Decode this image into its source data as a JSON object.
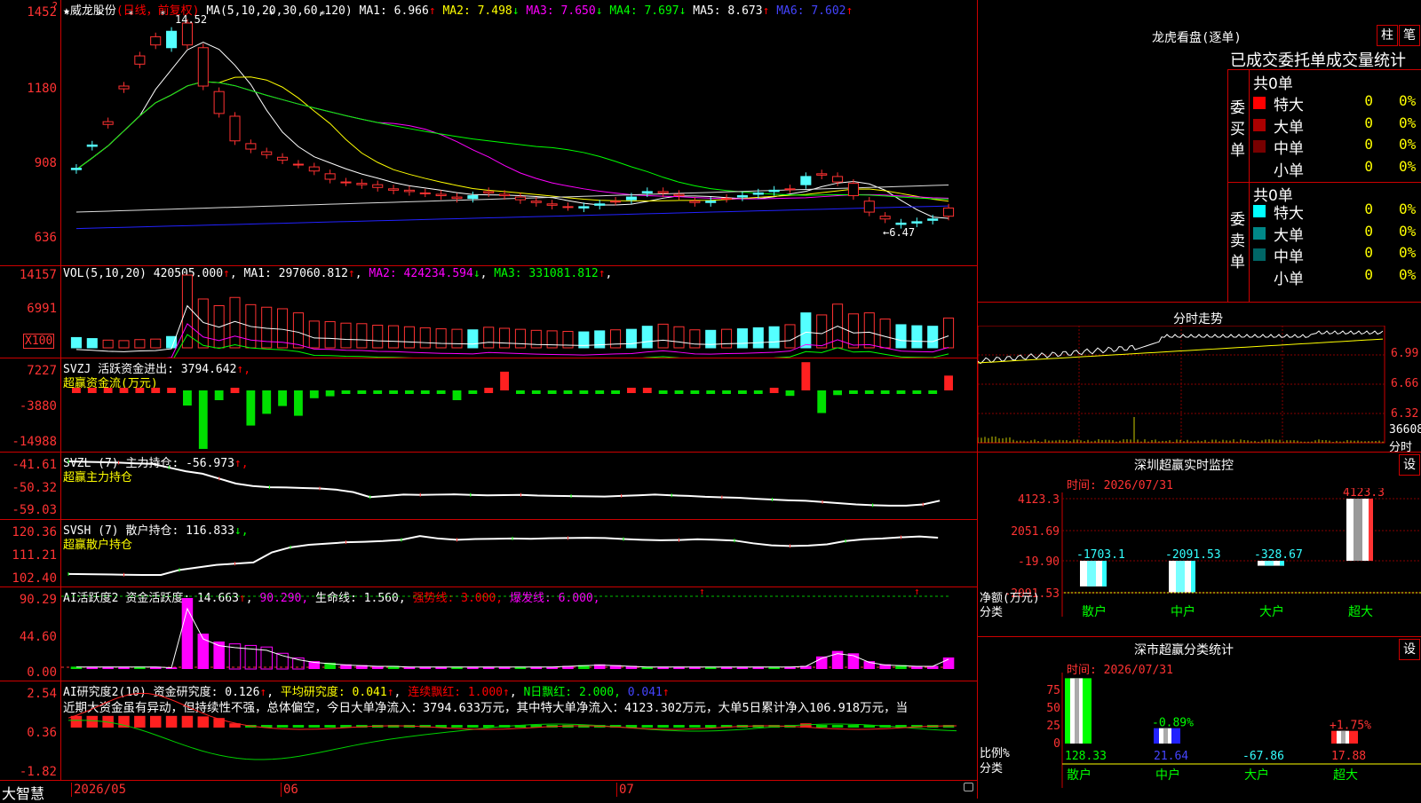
{
  "stock": {
    "name": "威龙股份",
    "mode": "(日线，前复权)"
  },
  "main": {
    "ma_label": "MA(5,10,20,30,60,120)",
    "ma": [
      {
        "label": "MA1:",
        "value": "6.966",
        "arrow": "↑",
        "color": "#ffffff"
      },
      {
        "label": "MA2:",
        "value": "7.498",
        "arrow": "↓",
        "color": "#ffff00"
      },
      {
        "label": "MA3:",
        "value": "7.650",
        "arrow": "↓",
        "color": "#ff00ff"
      },
      {
        "label": "MA4:",
        "value": "7.697",
        "arrow": "↓",
        "color": "#00ff00"
      },
      {
        "label": "MA5:",
        "value": "8.673",
        "arrow": "↑",
        "color": "#ffffff"
      },
      {
        "label": "MA6:",
        "value": "7.602",
        "arrow": "↑",
        "color": "#4444ff"
      }
    ],
    "ticks": [
      "1452",
      "1180",
      "908",
      "636"
    ],
    "high_label": "14.52",
    "low_label": "←6.47"
  },
  "vol": {
    "name": "VOL(5,10,20)",
    "value": "420505.000",
    "ma": [
      {
        "label": "MA1:",
        "value": "297060.812",
        "arrow": "↑",
        "color": "#ffffff"
      },
      {
        "label": "MA2:",
        "value": "424234.594",
        "arrow": "↓",
        "color": "#ff00ff"
      },
      {
        "label": "MA3:",
        "value": "331081.812",
        "arrow": "↑",
        "color": "#00ff00"
      }
    ],
    "ticks": [
      "14157",
      "6991"
    ],
    "unit": "X100"
  },
  "svzj": {
    "name": "SVZJ",
    "line1": "活跃资金进出: 3794.642",
    "arrow": "↑,",
    "line2": "超赢资金流(万元)",
    "ticks": [
      "7227",
      "-3880",
      "-14988"
    ]
  },
  "svzl": {
    "name": "SVZL (7)",
    "line1": "主力持仓: -56.973",
    "arrow": "↑,",
    "line2": "超赢主力持仓",
    "ticks": [
      "-41.61",
      "-50.32",
      "-59.03"
    ]
  },
  "svsh": {
    "name": "SVSH (7)",
    "line1": "散户持仓: 116.833",
    "arrow": "↓,",
    "line2": "超赢散户持仓",
    "ticks": [
      "120.36",
      "111.21",
      "102.40"
    ]
  },
  "ai1": {
    "name": "AI活跃度2",
    "label": "资金活跃度: 14.663",
    "v2": "90.290,",
    "v3": "生命线: 1.560,",
    "v4": "强势线: 3.000,",
    "v5": "爆发线: 6.000,",
    "ticks": [
      "90.29",
      "44.60",
      "0.00"
    ]
  },
  "ai2": {
    "name": "AI研究度2(10)",
    "label": "资金研究度: 0.126",
    "v2": "平均研究度: 0.041",
    "v3": "连续飘红: 1.000",
    "v4": "N日飘红: 2.000,",
    "v5": "0.041",
    "comment": "近期大资金虽有异动，但持续性不强，总体偏空，今日大单净流入：3794.633万元，其中特大单净流入：4123.302万元，大单5日累计净入106.918万元，当",
    "ticks": [
      "2.54",
      "0.36",
      "-1.82"
    ]
  },
  "xaxis": {
    "brand": "大智慧",
    "labels": [
      "2026/05",
      "06",
      "07"
    ]
  },
  "lhb": {
    "title": "龙虎看盘(逐单)",
    "btn1": "柱",
    "btn2": "笔",
    "subtitle": "已成交委托单成交量统计",
    "buy": {
      "side": "委买单",
      "count": "共0单",
      "rows": [
        {
          "label": "特大",
          "value": "0",
          "pct": "0%",
          "color": "#ff0000"
        },
        {
          "label": "大单",
          "value": "0",
          "pct": "0%",
          "color": "#aa0000"
        },
        {
          "label": "中单",
          "value": "0",
          "pct": "0%",
          "color": "#770000"
        },
        {
          "label": "小单",
          "value": "0",
          "pct": "0%",
          "color": "#000000"
        }
      ]
    },
    "sell": {
      "side": "委卖单",
      "count": "共0单",
      "rows": [
        {
          "label": "特大",
          "value": "0",
          "pct": "0%",
          "color": "#00ffff"
        },
        {
          "label": "大单",
          "value": "0",
          "pct": "0%",
          "color": "#008888"
        },
        {
          "label": "中单",
          "value": "0",
          "pct": "0%",
          "color": "#006666"
        },
        {
          "label": "小单",
          "value": "0",
          "pct": "0%",
          "color": "#000000"
        }
      ]
    }
  },
  "fenshi": {
    "title": "分时走势",
    "ticks": [
      "6.99",
      "6.66",
      "6.32"
    ],
    "vol": "36608",
    "vol_label": "分时"
  },
  "monitor": {
    "title": "深圳超赢实时监控",
    "btn": "设",
    "time": "时间: 2026/07/31",
    "ticks": [
      "4123.3",
      "2051.69",
      "-19.90",
      "-2091.53"
    ],
    "ylabel": "净额(万元)",
    "xlabel": "分类",
    "bars": [
      {
        "cat": "散户",
        "value": -1703.1,
        "label": "-1703.1"
      },
      {
        "cat": "中户",
        "value": -2091.53,
        "label": "-2091.53"
      },
      {
        "cat": "大户",
        "value": -328.67,
        "label": "-328.67"
      },
      {
        "cat": "超大",
        "value": 4123.3,
        "label": "4123.3"
      }
    ]
  },
  "classify": {
    "title": "深市超赢分类统计",
    "btn": "设",
    "time": "时间: 2026/07/31",
    "ticks": [
      "75",
      "50",
      "25",
      "0"
    ],
    "ylabel": "比例%",
    "xlabel": "分类",
    "bars": [
      {
        "cat": "散户",
        "value": 128.33,
        "label": "128.33",
        "bar_label": ""
      },
      {
        "cat": "中户",
        "value": 21.64,
        "label": "21.64",
        "bar_label": "-0.89%"
      },
      {
        "cat": "大户",
        "value": -67.86,
        "label": "-67.86",
        "bar_label": ""
      },
      {
        "cat": "超大",
        "value": 17.88,
        "label": "17.88",
        "bar_label": "+1.75%"
      }
    ]
  },
  "chart_data": [
    {
      "type": "candlestick",
      "title": "威龙股份",
      "y_ticks": [
        14.52,
        11.8,
        9.08,
        6.36
      ],
      "ylim": [
        6.0,
        15.0
      ],
      "high": 14.52,
      "low": 6.47,
      "close": [
        8.75,
        9.6,
        10.5,
        11.8,
        12.9,
        13.6,
        13.2,
        14.1,
        13.2,
        11.6,
        10.7,
        9.7,
        9.4,
        9.2,
        8.95,
        8.85,
        8.6,
        8.3,
        8.25,
        8.2,
        8.05,
        8.0,
        7.9,
        7.85,
        7.75,
        7.7,
        7.95,
        7.85,
        7.75,
        7.6,
        7.5,
        7.4,
        7.35,
        7.45,
        7.6,
        7.65,
        7.9,
        7.95,
        7.85,
        7.6,
        7.55,
        7.7,
        7.75,
        7.85,
        7.95,
        8.05,
        8.2,
        8.6,
        8.5,
        8.25,
        7.6,
        7.05,
        6.75,
        6.8,
        6.9,
        7.35
      ],
      "open": [
        8.8,
        9.65,
        10.4,
        11.7,
        12.6,
        13.3,
        13.8,
        13.3,
        11.8,
        10.8,
        9.8,
        9.5,
        9.3,
        9.1,
        8.95,
        8.7,
        8.4,
        8.3,
        8.2,
        8.1,
        8.0,
        7.95,
        7.9,
        7.8,
        7.7,
        7.8,
        7.9,
        7.8,
        7.65,
        7.55,
        7.45,
        7.4,
        7.4,
        7.5,
        7.6,
        7.75,
        7.95,
        7.9,
        7.8,
        7.55,
        7.6,
        7.7,
        7.8,
        7.9,
        8.0,
        8.05,
        8.5,
        8.55,
        8.3,
        7.8,
        7.2,
        6.95,
        6.8,
        6.85,
        6.95,
        7.05
      ]
    },
    {
      "type": "bar",
      "title": "VOL(5,10,20)",
      "y_ticks": [
        14157,
        6991
      ],
      "values": [
        2000,
        1800,
        1500,
        1400,
        1600,
        1700,
        2200,
        14157,
        9500,
        8200,
        9800,
        8400,
        7900,
        7600,
        6800,
        5200,
        5100,
        4800,
        4700,
        4400,
        4300,
        4100,
        3900,
        3700,
        3600,
        3500,
        4000,
        3800,
        3600,
        3400,
        3300,
        3200,
        3100,
        3300,
        3500,
        3600,
        4200,
        4600,
        4100,
        3500,
        3400,
        3600,
        3700,
        3900,
        4100,
        4500,
        6800,
        6400,
        8500,
        6600,
        6800,
        5600,
        4500,
        4300,
        4200,
        5800
      ]
    },
    {
      "type": "bar",
      "title": "SVZJ",
      "y_ticks": [
        7227,
        -3880,
        -14988
      ],
      "values": [
        1200,
        1200,
        1200,
        1200,
        1200,
        1200,
        1200,
        -3880,
        -14988,
        -2500,
        1200,
        -9000,
        -6000,
        -4000,
        -6500,
        -2000,
        -1500,
        -500,
        -200,
        -300,
        -200,
        -500,
        -300,
        -400,
        -2500,
        -300,
        600,
        4800,
        -400,
        -200,
        -300,
        -300,
        -200,
        -500,
        -600,
        400,
        1200,
        -500,
        -300,
        -300,
        -200,
        -300,
        -400,
        -500,
        1100,
        -1400,
        7227,
        -5800,
        -1200,
        -500,
        -400,
        -500,
        -300,
        -400,
        -300,
        3794
      ]
    },
    {
      "type": "line",
      "title": "SVZL (7)",
      "y_ticks": [
        -41.61,
        -50.32,
        -59.03
      ],
      "values": [
        -41.0,
        -41.2,
        -41.3,
        -41.5,
        -41.8,
        -42.0,
        -43.5,
        -45.0,
        -46.0,
        -48.0,
        -50.0,
        -51.0,
        -51.5,
        -51.6,
        -51.8,
        -52.0,
        -52.5,
        -53.5,
        -55.5,
        -55.0,
        -54.5,
        -54.6,
        -54.5,
        -54.4,
        -54.6,
        -54.8,
        -54.7,
        -54.6,
        -54.9,
        -55.0,
        -55.1,
        -55.2,
        -55.3,
        -55.0,
        -54.8,
        -54.5,
        -54.8,
        -55.0,
        -55.4,
        -55.6,
        -55.8,
        -56.2,
        -56.5,
        -56.8,
        -57.0,
        -57.5,
        -58.0,
        -58.5,
        -58.8,
        -59.0,
        -59.0,
        -58.5,
        -56.973
      ]
    },
    {
      "type": "line",
      "title": "SVSH (7)",
      "y_ticks": [
        120.36,
        111.21,
        102.4
      ],
      "values": [
        102.4,
        102.3,
        102.2,
        102.1,
        102.0,
        102.0,
        104.0,
        105.0,
        106.0,
        106.5,
        107.0,
        111.0,
        113.0,
        114.0,
        114.5,
        115.0,
        115.2,
        115.5,
        116.0,
        117.5,
        116.5,
        116.0,
        116.3,
        116.4,
        116.5,
        116.4,
        116.6,
        116.7,
        116.8,
        116.7,
        116.3,
        116.0,
        115.8,
        115.9,
        116.2,
        116.0,
        115.7,
        114.6,
        113.8,
        113.5,
        113.7,
        114.2,
        115.5,
        116.2,
        116.5,
        117.0,
        117.3,
        116.833
      ]
    },
    {
      "type": "bar",
      "title": "AI活跃度2",
      "y_ticks": [
        90.29,
        44.6,
        0.0
      ],
      "values": [
        3,
        3,
        3,
        3,
        3,
        3,
        2,
        90.29,
        45,
        35,
        32,
        30,
        28,
        20,
        14,
        10,
        8,
        6,
        5,
        4,
        4,
        3,
        3,
        3,
        3,
        3,
        3,
        3,
        3,
        3,
        3,
        4,
        5,
        6,
        5,
        4,
        3,
        3,
        3,
        3,
        3,
        3,
        3,
        3,
        3,
        3,
        4,
        16,
        23,
        20,
        10,
        6,
        5,
        4,
        4,
        14.663
      ]
    },
    {
      "type": "bar",
      "title": "AI研究度2(10)",
      "y_ticks": [
        2.54,
        0.36,
        -1.82
      ],
      "values": [
        1.1,
        1.1,
        1.1,
        1.1,
        1.1,
        1.1,
        1.1,
        1.1,
        1.05,
        0.9,
        0.4,
        0.2,
        0.1,
        0.1,
        0.05,
        0.05,
        0.05,
        0.05,
        0.05,
        0.05,
        0.05,
        0.05,
        0.05,
        0.05,
        0.05,
        0.05,
        0.05,
        0.05,
        0.05,
        0.05,
        0.05,
        0.05,
        0.05,
        0.05,
        0.05,
        0.05,
        0.05,
        0.05,
        0.05,
        0.05,
        0.05,
        0.05,
        0.05,
        0.05,
        0.05,
        0.05,
        0.4,
        0.05,
        0.05,
        0.05,
        0.05,
        0.05,
        0.05,
        0.05,
        0.05,
        0.126
      ]
    }
  ]
}
